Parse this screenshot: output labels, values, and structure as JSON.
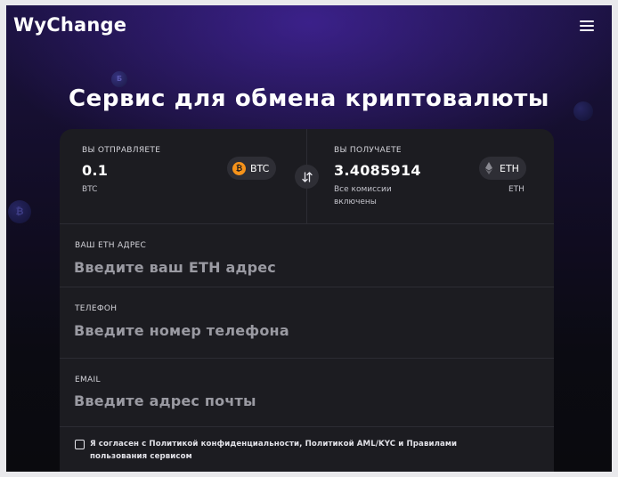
{
  "header": {
    "logo": "WyChange"
  },
  "hero": {
    "title": "Сервис для обмена криптовалюты"
  },
  "exchange": {
    "send": {
      "label": "ВЫ ОТПРАВЛЯЕТЕ",
      "amount": "0.1",
      "currency_sub": "BTC",
      "coin": "BTC",
      "coin_color": "#f7931a"
    },
    "receive": {
      "label": "ВЫ ПОЛУЧАЕТЕ",
      "amount": "3.4085914",
      "note_line1": "Все комиссии",
      "note_line2": "включены",
      "coin": "ETH",
      "currency_sub": "ETH"
    }
  },
  "form": {
    "eth_address": {
      "label": "ВАШ ETH АДРЕС",
      "placeholder": "Введите ваш ETH адрес"
    },
    "phone": {
      "label": "ТЕЛЕФОН",
      "placeholder": "Введите номер телефона"
    },
    "email": {
      "label": "EMAIL",
      "placeholder": "Введите адрес почты"
    },
    "consent": {
      "line1": "Я согласен с Политикой конфиденциальности, Политикой AML/KYC  и Правилами",
      "line2": "пользования сервисом",
      "checked": false
    }
  },
  "colors": {
    "accent": "#5a2ed0",
    "card": "#1c1c21"
  }
}
